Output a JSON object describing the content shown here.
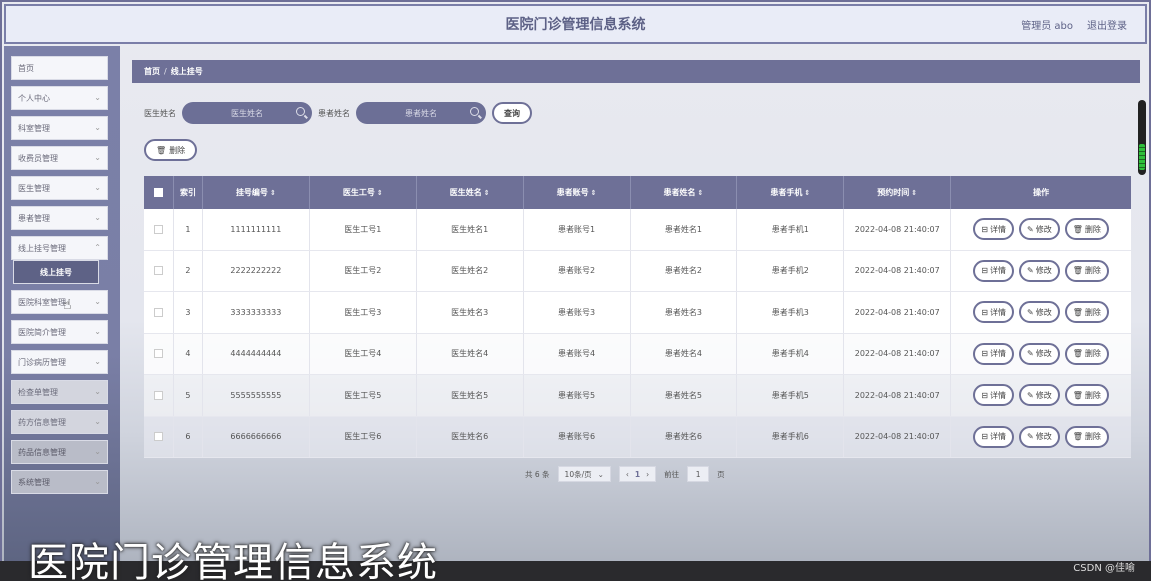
{
  "header": {
    "title": "医院门诊管理信息系统",
    "user": "管理员 abo",
    "logout": "退出登录"
  },
  "sidebar": {
    "items": [
      {
        "label": "首页",
        "chevron": false
      },
      {
        "label": "个人中心",
        "chevron": true
      },
      {
        "label": "科室管理",
        "chevron": true
      },
      {
        "label": "收费员管理",
        "chevron": true
      },
      {
        "label": "医生管理",
        "chevron": true
      },
      {
        "label": "患者管理",
        "chevron": true
      },
      {
        "label": "线上挂号管理",
        "chevron": true
      },
      {
        "label": "线上挂号",
        "active": true
      },
      {
        "label": "医院科室管理",
        "chevron": true
      },
      {
        "label": "医院简介管理",
        "chevron": true
      },
      {
        "label": "门诊病历管理",
        "chevron": true
      },
      {
        "label": "检查单管理",
        "chevron": true
      },
      {
        "label": "药方信息管理",
        "chevron": true
      },
      {
        "label": "药品信息管理",
        "chevron": true
      },
      {
        "label": "系统管理",
        "chevron": true
      }
    ]
  },
  "breadcrumb": {
    "home": "首页",
    "separator": "/",
    "current": "线上挂号"
  },
  "search": {
    "doctor_label": "医生姓名",
    "doctor_placeholder": "医生姓名",
    "patient_label": "患者姓名",
    "patient_placeholder": "患者姓名",
    "query_button": "查询"
  },
  "actions": {
    "delete_button": "删除"
  },
  "table": {
    "columns": [
      "索引",
      "挂号编号",
      "医生工号",
      "医生姓名",
      "患者账号",
      "患者姓名",
      "患者手机",
      "预约时间",
      "操作"
    ],
    "rows": [
      {
        "index": "1",
        "reg_no": "1111111111",
        "doc_id": "医生工号1",
        "doc_name": "医生姓名1",
        "pat_acc": "患者账号1",
        "pat_name": "患者姓名1",
        "pat_phone": "患者手机1",
        "time": "2022-04-08 21:40:07"
      },
      {
        "index": "2",
        "reg_no": "2222222222",
        "doc_id": "医生工号2",
        "doc_name": "医生姓名2",
        "pat_acc": "患者账号2",
        "pat_name": "患者姓名2",
        "pat_phone": "患者手机2",
        "time": "2022-04-08 21:40:07"
      },
      {
        "index": "3",
        "reg_no": "3333333333",
        "doc_id": "医生工号3",
        "doc_name": "医生姓名3",
        "pat_acc": "患者账号3",
        "pat_name": "患者姓名3",
        "pat_phone": "患者手机3",
        "time": "2022-04-08 21:40:07"
      },
      {
        "index": "4",
        "reg_no": "4444444444",
        "doc_id": "医生工号4",
        "doc_name": "医生姓名4",
        "pat_acc": "患者账号4",
        "pat_name": "患者姓名4",
        "pat_phone": "患者手机4",
        "time": "2022-04-08 21:40:07"
      },
      {
        "index": "5",
        "reg_no": "5555555555",
        "doc_id": "医生工号5",
        "doc_name": "医生姓名5",
        "pat_acc": "患者账号5",
        "pat_name": "患者姓名5",
        "pat_phone": "患者手机5",
        "time": "2022-04-08 21:40:07"
      },
      {
        "index": "6",
        "reg_no": "6666666666",
        "doc_id": "医生工号6",
        "doc_name": "医生姓名6",
        "pat_acc": "患者账号6",
        "pat_name": "患者姓名6",
        "pat_phone": "患者手机6",
        "time": "2022-04-08 21:40:07"
      }
    ],
    "row_actions": {
      "detail": "详情",
      "edit": "修改",
      "delete": "删除"
    }
  },
  "pagination": {
    "total": "共 6 条",
    "page_size": "10条/页",
    "current_page": "1",
    "goto_label": "前往",
    "goto_value": "1",
    "page_suffix": "页"
  },
  "overlay": {
    "caption": "医院门诊管理信息系统",
    "watermark": "CSDN @佳喻"
  },
  "colors": {
    "accent": "#6e7097",
    "header_bg": "#e9ecf7",
    "sidebar_bg": "#7b80a8"
  }
}
